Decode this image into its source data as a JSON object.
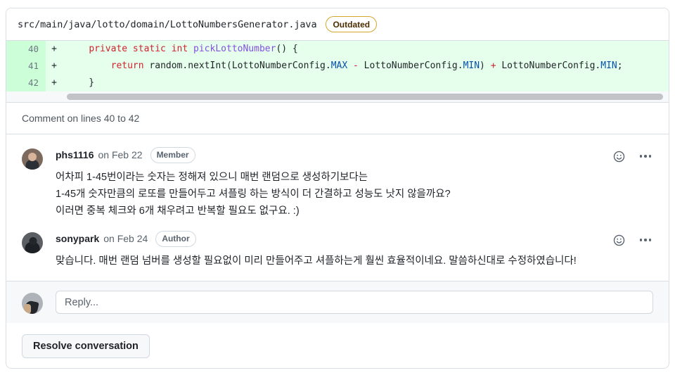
{
  "file_header": {
    "path": "src/main/java/lotto/domain/LottoNumbersGenerator.java",
    "badge": "Outdated"
  },
  "diff": {
    "lines": [
      {
        "number": "40",
        "marker": "+",
        "tokens": [
          {
            "t": "    ",
            "c": "plain"
          },
          {
            "t": "private static int ",
            "c": "keyword"
          },
          {
            "t": "pickLottoNumber",
            "c": "function"
          },
          {
            "t": "() {",
            "c": "plain"
          }
        ]
      },
      {
        "number": "41",
        "marker": "+",
        "tokens": [
          {
            "t": "        ",
            "c": "plain"
          },
          {
            "t": "return",
            "c": "keyword"
          },
          {
            "t": " random.nextInt(LottoNumberConfig.",
            "c": "plain"
          },
          {
            "t": "MAX",
            "c": "constant"
          },
          {
            "t": " ",
            "c": "plain"
          },
          {
            "t": "-",
            "c": "operator"
          },
          {
            "t": " LottoNumberConfig.",
            "c": "plain"
          },
          {
            "t": "MIN",
            "c": "constant"
          },
          {
            "t": ") ",
            "c": "plain"
          },
          {
            "t": "+",
            "c": "operator"
          },
          {
            "t": " LottoNumberConfig.",
            "c": "plain"
          },
          {
            "t": "MIN",
            "c": "constant"
          },
          {
            "t": ";",
            "c": "plain"
          }
        ]
      },
      {
        "number": "42",
        "marker": "+",
        "tokens": [
          {
            "t": "    }",
            "c": "plain"
          }
        ]
      }
    ]
  },
  "comment_on_lines_label": "Comment on lines 40 to 42",
  "comments": [
    {
      "author": "phs1116",
      "timestamp": "on Feb 22",
      "role_badge": "Member",
      "avatar_style": "av-phs",
      "text_lines": [
        "어차피 1-45번이라는 숫자는 정해져 있으니 매번 랜덤으로 생성하기보다는",
        "1-45개 숫자만큼의 로또를 만들어두고 셔플링 하는 방식이 더 간결하고 성능도 낫지 않을까요?",
        "이러면 중복 체크와 6개 채우려고 반복할 필요도 없구요. :)"
      ]
    },
    {
      "author": "sonypark",
      "timestamp": "on Feb 24",
      "role_badge": "Author",
      "avatar_style": "av-sony",
      "text_lines": [
        "맞습니다. 매번 랜덤 넘버를 생성할 필요없이 미리 만들어주고 셔플하는게 훨씬 효율적이네요. 말씀하신대로 수정하였습니다!"
      ]
    }
  ],
  "actions": {
    "reaction_icon": "smiley-icon",
    "overflow_icon": "kebab-menu-icon"
  },
  "reply": {
    "placeholder": "Reply...",
    "value": ""
  },
  "footer": {
    "resolve_label": "Resolve conversation"
  },
  "colors": {
    "diff_add_bg": "#e6ffec",
    "diff_add_gutter_bg": "#ccffd8",
    "badge_outdated_border": "#d4a72c",
    "card_border": "#d8dee4",
    "muted_text": "#59636e"
  }
}
